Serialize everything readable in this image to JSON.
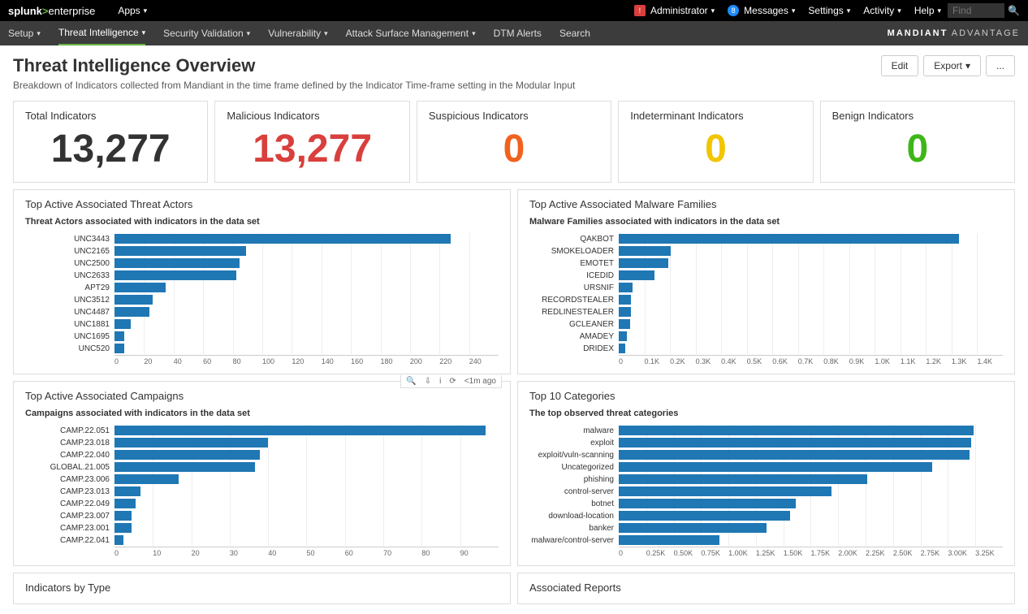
{
  "topbar": {
    "logo_prefix": "splunk",
    "logo_suffix": "enterprise",
    "apps": "Apps",
    "admin_badge": "!",
    "admin": "Administrator",
    "msg_count": "8",
    "messages": "Messages",
    "settings": "Settings",
    "activity": "Activity",
    "help": "Help",
    "find_placeholder": "Find"
  },
  "navbar": {
    "items": [
      "Setup",
      "Threat Intelligence",
      "Security Validation",
      "Vulnerability",
      "Attack Surface Management",
      "DTM Alerts",
      "Search"
    ],
    "brand_a": "MANDIANT",
    "brand_b": "ADVANTAGE"
  },
  "header": {
    "title": "Threat Intelligence Overview",
    "desc": "Breakdown of Indicators collected from Mandiant in the time frame defined by the Indicator Time-frame setting in the Modular Input",
    "edit": "Edit",
    "export": "Export",
    "more": "..."
  },
  "stats": [
    {
      "label": "Total Indicators",
      "value": "13,277",
      "color": "#333"
    },
    {
      "label": "Malicious Indicators",
      "value": "13,277",
      "color": "#d93f3c"
    },
    {
      "label": "Suspicious Indicators",
      "value": "0",
      "color": "#f0621e"
    },
    {
      "label": "Indeterminant Indicators",
      "value": "0",
      "color": "#f2c500"
    },
    {
      "label": "Benign Indicators",
      "value": "0",
      "color": "#3fb618"
    }
  ],
  "panels": {
    "actors": {
      "title": "Top Active Associated Threat Actors",
      "subtitle": "Threat Actors associated with indicators in the data set"
    },
    "malware": {
      "title": "Top Active Associated Malware Families",
      "subtitle": "Malware Families associated with indicators in the data set"
    },
    "campaigns": {
      "title": "Top Active Associated Campaigns",
      "subtitle": "Campaigns associated with indicators in the data set"
    },
    "categories": {
      "title": "Top 10 Categories",
      "subtitle": "The top observed threat categories"
    },
    "indicators": {
      "title": "Indicators by Type"
    },
    "reports": {
      "title": "Associated Reports"
    }
  },
  "tools": {
    "refresh_text": "<1m ago"
  },
  "chart_data": [
    {
      "id": "actors",
      "type": "bar",
      "orientation": "horizontal",
      "categories": [
        "UNC3443",
        "UNC2165",
        "UNC2500",
        "UNC2633",
        "APT29",
        "UNC3512",
        "UNC4487",
        "UNC1881",
        "UNC1695",
        "UNC520"
      ],
      "values": [
        210,
        82,
        78,
        76,
        32,
        24,
        22,
        10,
        6,
        6
      ],
      "xlim": [
        0,
        240
      ],
      "xticks": [
        0,
        20,
        40,
        60,
        80,
        100,
        120,
        140,
        160,
        180,
        200,
        220,
        240
      ]
    },
    {
      "id": "malware",
      "type": "bar",
      "orientation": "horizontal",
      "categories": [
        "QAKBOT",
        "SMOKELOADER",
        "EMOTET",
        "ICEDID",
        "URSNIF",
        "RECORDSTEALER",
        "REDLINESTEALER",
        "GCLEANER",
        "AMADEY",
        "DRIDEX"
      ],
      "values": [
        1240,
        190,
        180,
        130,
        50,
        45,
        45,
        40,
        30,
        25
      ],
      "xlim": [
        0,
        1400
      ],
      "xticks": [
        "0",
        "0.1K",
        "0.2K",
        "0.3K",
        "0.4K",
        "0.5K",
        "0.6K",
        "0.7K",
        "0.8K",
        "0.9K",
        "1.0K",
        "1.1K",
        "1.2K",
        "1.3K",
        "1.4K"
      ]
    },
    {
      "id": "campaigns",
      "type": "bar",
      "orientation": "horizontal",
      "categories": [
        "CAMP.22.051",
        "CAMP.23.018",
        "CAMP.22.040",
        "GLOBAL.21.005",
        "CAMP.23.006",
        "CAMP.23.013",
        "CAMP.22.049",
        "CAMP.23.007",
        "CAMP.23.001",
        "CAMP.22.041"
      ],
      "values": [
        87,
        36,
        34,
        33,
        15,
        6,
        5,
        4,
        4,
        2
      ],
      "xlim": [
        0,
        90
      ],
      "xticks": [
        0,
        10,
        20,
        30,
        40,
        50,
        60,
        70,
        80,
        90
      ]
    },
    {
      "id": "categories",
      "type": "bar",
      "orientation": "horizontal",
      "categories": [
        "malware",
        "exploit",
        "exploit/vuln-scanning",
        "Uncategorized",
        "phishing",
        "control-server",
        "botnet",
        "download-location",
        "banker",
        "malware/control-server"
      ],
      "values": [
        3000,
        2980,
        2970,
        2650,
        2100,
        1800,
        1500,
        1450,
        1250,
        850
      ],
      "xlim": [
        0,
        3250
      ],
      "xticks": [
        "0",
        "0.25K",
        "0.50K",
        "0.75K",
        "1.00K",
        "1.25K",
        "1.50K",
        "1.75K",
        "2.00K",
        "2.25K",
        "2.50K",
        "2.75K",
        "3.00K",
        "3.25K"
      ]
    }
  ]
}
